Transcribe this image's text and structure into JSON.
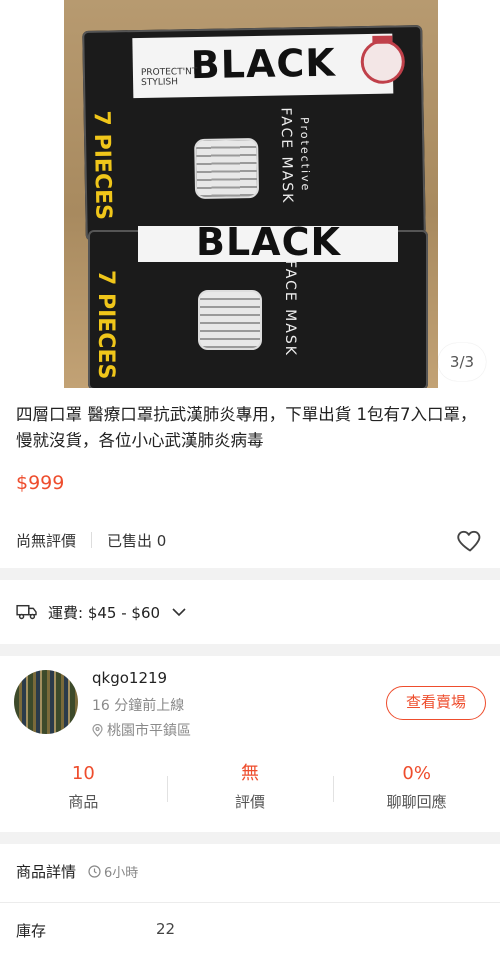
{
  "product": {
    "image_counter": "3/3",
    "pack_brand": "BLACK",
    "pack_sub": "PROTECT'NT\nSTYLISH",
    "pack_face_mask": "FACE MASK",
    "pack_protective": "Protective",
    "pack_pieces": "7 PIECES",
    "title": "四層口罩 醫療口罩抗武漢肺炎專用，下單出貨 1包有7入口罩，慢就沒貨，各位小心武漢肺炎病毒",
    "price": "$999",
    "rating_text": "尚無評價",
    "sold_text": "已售出 0"
  },
  "shipping": {
    "label": "運費: $45 - $60"
  },
  "seller": {
    "name": "qkgo1219",
    "online": "16 分鐘前上線",
    "location": "桃園市平鎮區",
    "view_shop": "查看賣場",
    "stats": [
      {
        "value": "10",
        "label": "商品"
      },
      {
        "value": "無",
        "label": "評價"
      },
      {
        "value": "0%",
        "label": "聊聊回應"
      }
    ]
  },
  "details": {
    "heading": "商品詳情",
    "time": "6小時",
    "stock_label": "庫存",
    "stock_value": "22"
  },
  "colors": {
    "accent": "#ee4d2d",
    "muted": "#8a8a8a",
    "section_gap": "#f2f2f2"
  }
}
